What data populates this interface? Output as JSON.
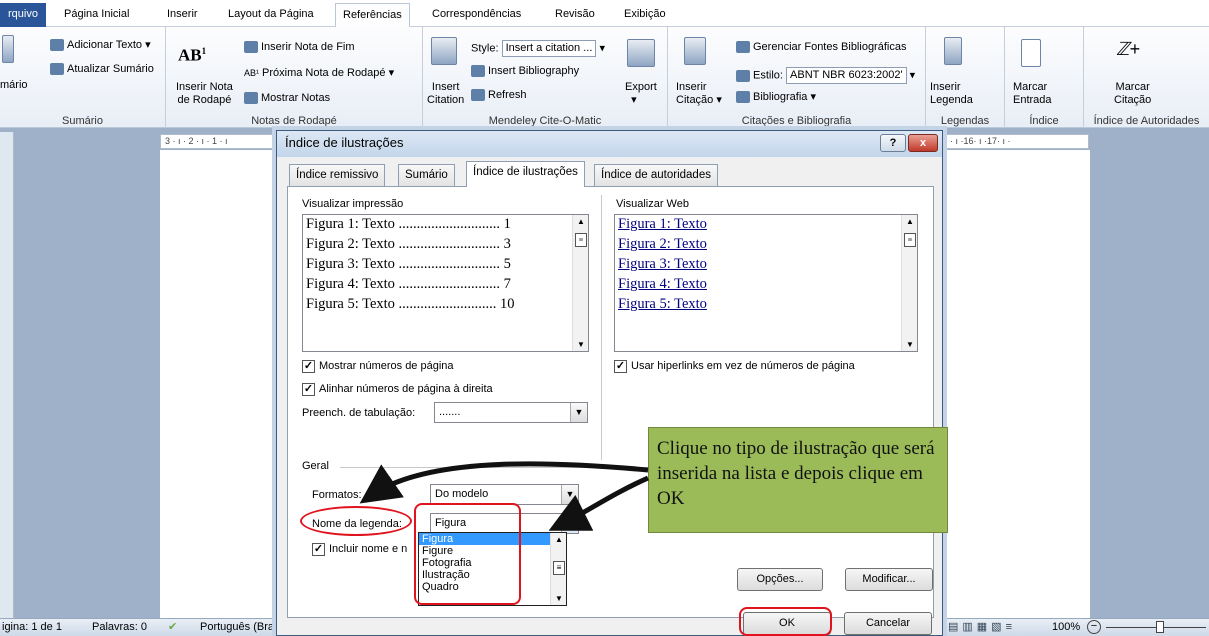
{
  "tabs": {
    "file": "rquivo",
    "home": "Página Inicial",
    "insert": "Inserir",
    "layout": "Layout da Página",
    "references": "Referências",
    "mailings": "Correspondências",
    "review": "Revisão",
    "view": "Exibição"
  },
  "ribbon": {
    "toc": {
      "add_text": "Adicionar Texto",
      "update": "Atualizar Sumário",
      "big": "mário",
      "group": "Sumário"
    },
    "footnotes": {
      "insert_note": "Inserir Nota",
      "insert_note2": "de Rodapé",
      "endnote": "Inserir Nota de Fim",
      "next": "Próxima Nota de Rodapé",
      "show": "Mostrar Notas",
      "group": "Notas de Rodapé"
    },
    "mendeley": {
      "style_label": "Style:",
      "style_value": "Insert a citation ...",
      "insert_bib": "Insert Bibliography",
      "refresh": "Refresh",
      "insert_citation": "Insert",
      "insert_citation2": "Citation",
      "export": "Export",
      "group": "Mendeley Cite-O-Matic"
    },
    "citations": {
      "insert": "Inserir",
      "insert2": "Citação",
      "manage": "Gerenciar Fontes Bibliográficas",
      "style_label": "Estilo:",
      "style_value": "ABNT NBR 6023:2002'",
      "bibliography": "Bibliografia",
      "group": "Citações e Bibliografia"
    },
    "captions": {
      "insert": "Inserir",
      "insert2": "Legenda",
      "group": "Legendas"
    },
    "index": {
      "mark": "Marcar",
      "mark2": "Entrada",
      "group": "Índice"
    },
    "authorities": {
      "mark": "Marcar",
      "mark2": "Citação",
      "group": "Índice de Autoridades"
    }
  },
  "ruler": {
    "left": "3 · ı · 2 · ı · 1 · ı",
    "right": "· ı ·16· ı ·17· ı ·"
  },
  "dialog": {
    "title": "Índice de ilustrações",
    "help": "?",
    "close": "x",
    "tabs": [
      "Índice remissivo",
      "Sumário",
      "Índice de ilustrações",
      "Índice de autoridades"
    ],
    "print_label": "Visualizar impressão",
    "print_lines": [
      "Figura 1: Texto ............................ 1",
      "Figura 2: Texto ............................ 3",
      "Figura 3: Texto ............................ 5",
      "Figura 4: Texto ............................ 7",
      "Figura 5: Texto ........................... 10"
    ],
    "web_label": "Visualizar Web",
    "web_lines": [
      "Figura 1: Texto",
      "Figura 2: Texto",
      "Figura 3: Texto",
      "Figura 4: Texto",
      "Figura 5: Texto"
    ],
    "show_page_numbers": "Mostrar números de página",
    "align_right": "Alinhar números de página à direita",
    "tab_leader_label": "Preench. de tabulação:",
    "tab_leader_value": ".......",
    "hyperlinks": "Usar hiperlinks em vez de números de página",
    "general": "Geral",
    "formats_label": "Formatos:",
    "formats_value": "Do modelo",
    "caption_label": "Nome da legenda:",
    "caption_value": "Figura",
    "include_label": "Incluir nome e n",
    "options": [
      "Figura",
      "Figure",
      "Fotografia",
      "Ilustração",
      "Quadro"
    ],
    "options_btn": "Opções...",
    "modify_btn": "Modificar...",
    "ok": "OK",
    "cancel": "Cancelar"
  },
  "callout": {
    "text": "Clique no tipo de ilustração que será inserida na lista e depois clique em OK"
  },
  "status": {
    "page": "igina: 1 de 1",
    "words": "Palavras: 0",
    "language": "Português (Bra",
    "zoom": "100%"
  },
  "colors": {
    "accent": "#2a5699",
    "callout": "#9bbb59",
    "highlight": "#e0141e",
    "selection": "#3399ff"
  }
}
